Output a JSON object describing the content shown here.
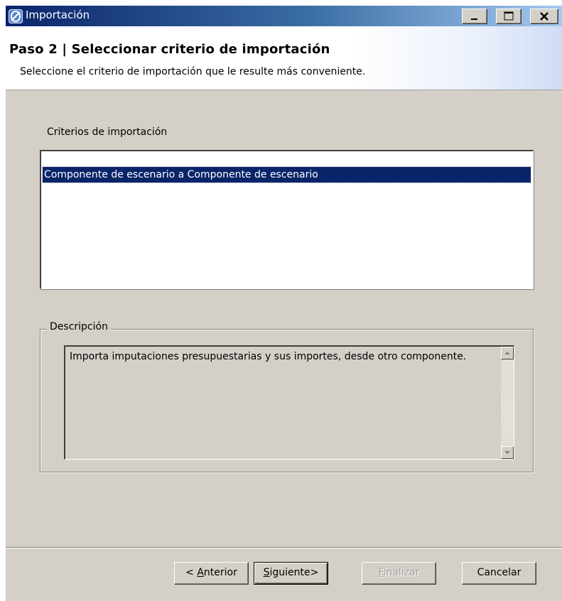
{
  "window": {
    "title": "Importación",
    "icons": {
      "app": "app-logo-icon",
      "minimize": "minimize-icon",
      "maximize": "maximize-icon",
      "close": "close-icon"
    }
  },
  "header": {
    "title": "Paso 2 | Seleccionar criterio de importación",
    "subtitle": "Seleccione el criterio de importación que le resulte más conveniente."
  },
  "criteria": {
    "label": "Criterios de importación",
    "items": [
      "Componente de escenario a Componente de escenario"
    ],
    "selected_index": 0
  },
  "description": {
    "label": "Descripción",
    "text": "Importa imputaciones presupuestarias y sus importes, desde otro componente."
  },
  "buttons": {
    "anterior": {
      "mnemonic": "A",
      "rest": "nterior",
      "prefix": "< "
    },
    "siguiente": {
      "mnemonic": "S",
      "rest": "iguiente>"
    },
    "finalizar": {
      "mnemonic": "F",
      "rest": "inalizar"
    },
    "cancelar": {
      "label": "Cancelar"
    }
  }
}
